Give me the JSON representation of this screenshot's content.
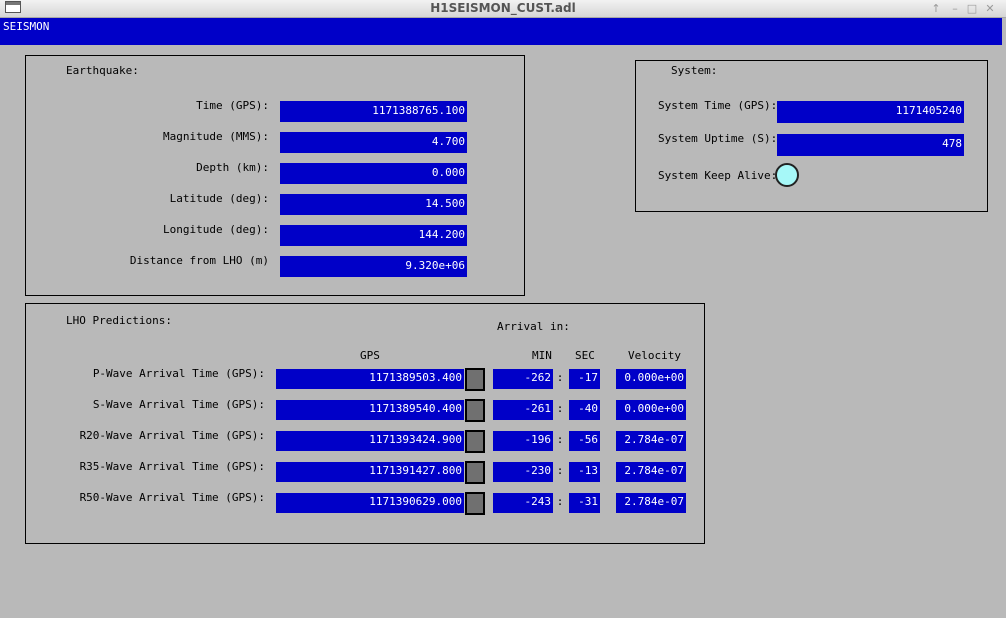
{
  "window": {
    "title": "H1SEISMON_CUST.adl",
    "controls": [
      "↑",
      "–",
      "□",
      "✕"
    ]
  },
  "header": {
    "label": "SEISMON"
  },
  "earthquake": {
    "title": "Earthquake:",
    "fields": [
      {
        "label": "Time (GPS):",
        "value": "1171388765.100"
      },
      {
        "label": "Magnitude (MMS):",
        "value": "4.700"
      },
      {
        "label": "Depth (km):",
        "value": "0.000"
      },
      {
        "label": "Latitude (deg):",
        "value": "14.500"
      },
      {
        "label": "Longitude (deg):",
        "value": "144.200"
      },
      {
        "label": "Distance from LHO (m)",
        "value": "9.320e+06"
      }
    ]
  },
  "system": {
    "title": "System:",
    "time_label": "System Time (GPS):",
    "time_value": "1171405240",
    "uptime_label": "System Uptime (S):",
    "uptime_value": "478",
    "keepalive_label": "System Keep Alive:",
    "keepalive_color": "#a6f8f8"
  },
  "predictions": {
    "title": "LHO Predictions:",
    "arrival_label": "Arrival in:",
    "headers": {
      "gps": "GPS",
      "min": "MIN",
      "sec": "SEC",
      "velocity": "Velocity"
    },
    "rows": [
      {
        "label": "P-Wave Arrival Time (GPS):",
        "gps": "1171389503.400",
        "min": "-262",
        "sep": ":",
        "sec": "-17",
        "velocity": "0.000e+00"
      },
      {
        "label": "S-Wave Arrival Time (GPS):",
        "gps": "1171389540.400",
        "min": "-261",
        "sep": ":",
        "sec": "-40",
        "velocity": "0.000e+00"
      },
      {
        "label": "R20-Wave Arrival Time (GPS):",
        "gps": "1171393424.900",
        "min": "-196",
        "sep": ":",
        "sec": "-56",
        "velocity": "2.784e-07"
      },
      {
        "label": "R35-Wave Arrival Time (GPS):",
        "gps": "1171391427.800",
        "min": "-230",
        "sep": ":",
        "sec": "-13",
        "velocity": "2.784e-07"
      },
      {
        "label": "R50-Wave Arrival Time (GPS):",
        "gps": "1171390629.000",
        "min": "-243",
        "sep": ":",
        "sec": "-31",
        "velocity": "2.784e-07"
      }
    ]
  },
  "colors": {
    "display_bg": "#0000c8",
    "panel_bg": "#b9b9b9",
    "indicator": "#707070"
  }
}
